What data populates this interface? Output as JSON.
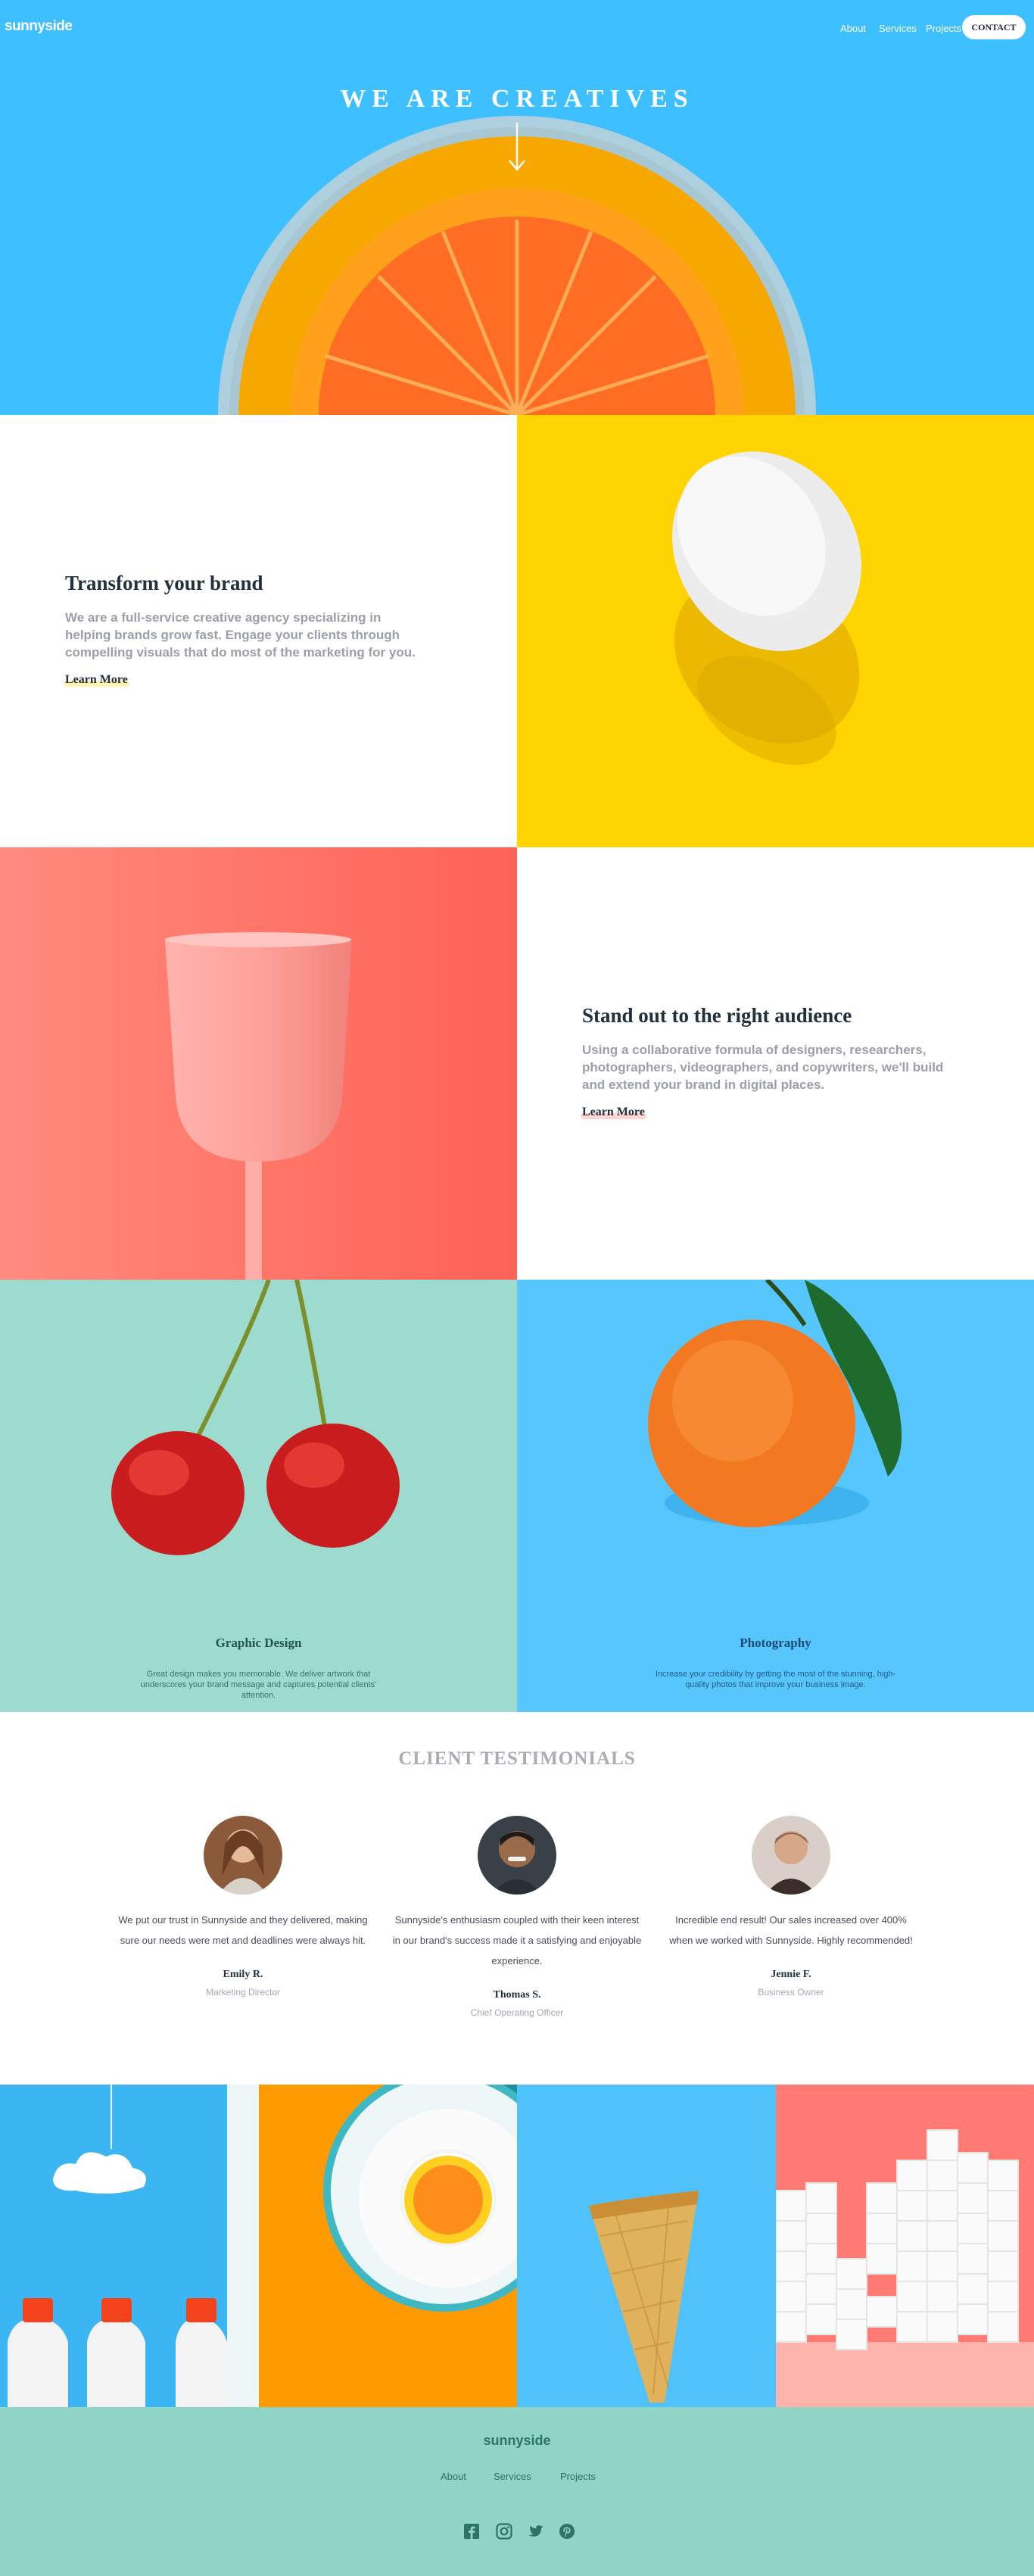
{
  "header": {
    "logo": "sunnyside",
    "nav": [
      "About",
      "Services",
      "Projects"
    ],
    "contact_label": "CONTACT"
  },
  "hero": {
    "title": "WE ARE CREATIVES",
    "arrow_icon": "arrow-down-icon"
  },
  "features": [
    {
      "heading": "Transform your brand",
      "body": "We are a full-service creative agency specializing in helping brands grow fast. Engage your clients through compelling visuals that do most of the marketing for you.",
      "link": "Learn More",
      "accent": "#fad400"
    },
    {
      "heading": "Stand out to the right audience",
      "body": "Using a collaborative formula of designers, researchers, photographers, videographers, and copywriters, we'll build and extend your brand in digital places.",
      "link": "Learn More",
      "accent": "#fe7866"
    }
  ],
  "services": [
    {
      "heading": "Graphic Design",
      "body": "Great design makes you memorable. We deliver artwork that underscores your brand message and captures potential clients' attention.",
      "color": "#24564e"
    },
    {
      "heading": "Photography",
      "body": "Increase your credibility by getting the most of the stunning, high-quality photos that improve your business image.",
      "color": "#194a75"
    }
  ],
  "testimonials": {
    "title": "CLIENT TESTIMONIALS",
    "items": [
      {
        "quote": "We put our trust in Sunnyside and they delivered, making sure our needs were met and deadlines were always hit.",
        "name": "Emily R.",
        "role": "Marketing Director"
      },
      {
        "quote": "Sunnyside's enthusiasm coupled with their keen interest in our brand's success made it a satisfying and enjoyable experience.",
        "name": "Thomas S.",
        "role": "Chief Operating Officer"
      },
      {
        "quote": "Incredible end result! Our sales increased over 400% when we worked with Sunnyside. Highly recommended!",
        "name": "Jennie F.",
        "role": "Business Owner"
      }
    ]
  },
  "footer": {
    "logo": "sunnyside",
    "nav": [
      "About",
      "Services",
      "Projects"
    ],
    "social_icons": [
      "facebook-icon",
      "instagram-icon",
      "twitter-icon",
      "pinterest-icon"
    ]
  },
  "colors": {
    "hero_blue": "#3ebfff",
    "yellow": "#fad400",
    "coral": "#fe7866",
    "mint": "#90d4c5",
    "dark": "#23303e"
  }
}
